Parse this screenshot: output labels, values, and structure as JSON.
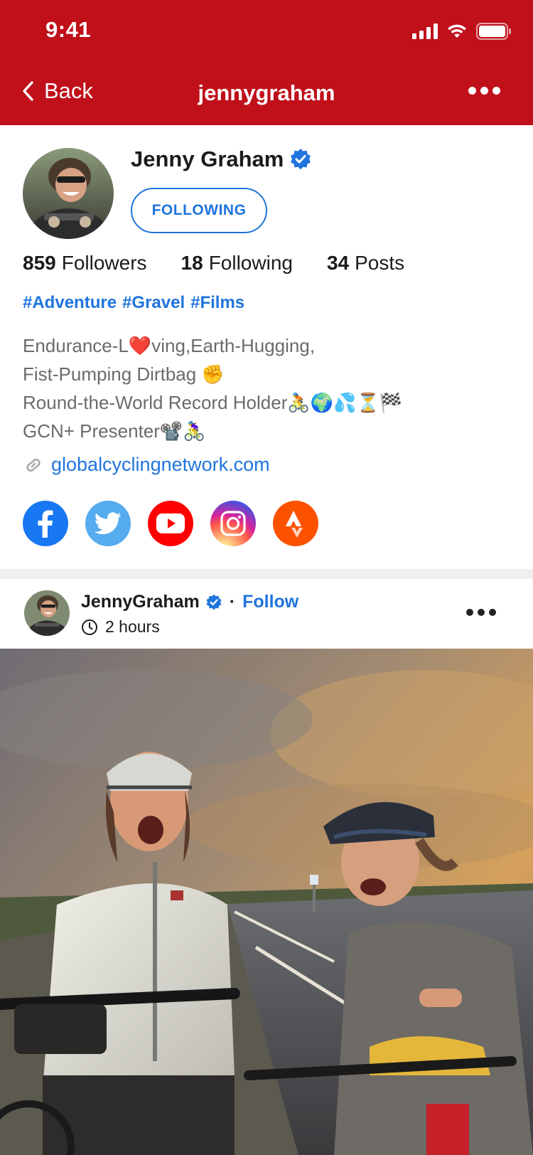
{
  "status_bar": {
    "time": "9:41"
  },
  "nav": {
    "back_label": "Back",
    "title": "jennygraham"
  },
  "profile": {
    "name": "Jenny Graham",
    "follow_button": "FOLLOWING",
    "stats": [
      {
        "count": "859",
        "label": "Followers"
      },
      {
        "count": "18",
        "label": "Following"
      },
      {
        "count": "34",
        "label": "Posts"
      }
    ],
    "tags": [
      "#Adventure",
      "#Gravel",
      "#Films"
    ],
    "bio": [
      "Endurance-L❤️ving,Earth-Hugging,",
      "Fist-Pumping Dirtbag ✊",
      "Round-the-World Record Holder🚴🌍💦⏳🏁",
      "GCN+ Presenter📽️🚴‍♀️"
    ],
    "website": "globalcyclingnetwork.com",
    "socials": [
      "facebook-icon",
      "twitter-icon",
      "youtube-icon",
      "instagram-icon",
      "strava-icon"
    ]
  },
  "post": {
    "author": "JennyGraham",
    "separator": "·",
    "follow_label": "Follow",
    "time": "2 hours"
  },
  "colors": {
    "brand_red": "#c0101a",
    "link_blue": "#1f74dd",
    "muted_text": "#6b6b6b"
  }
}
